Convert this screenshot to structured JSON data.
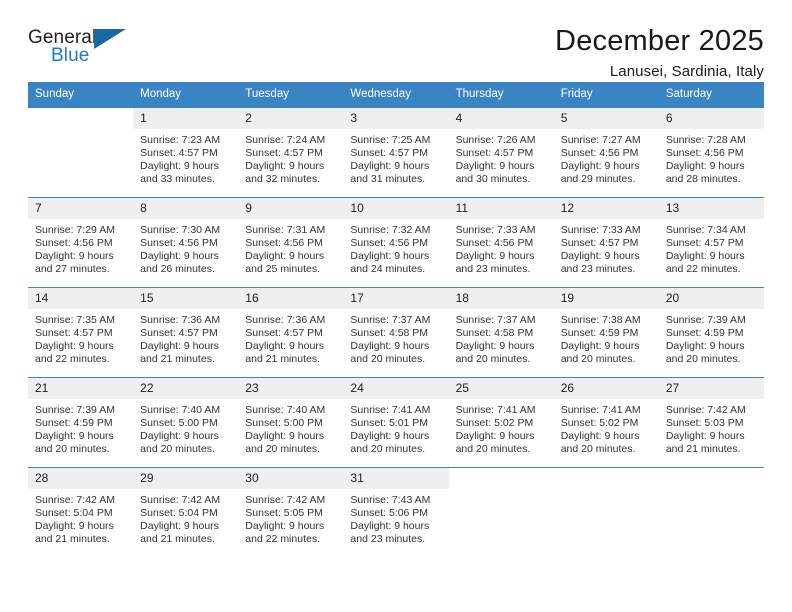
{
  "logo": {
    "word_one": "General",
    "word_two": "Blue",
    "triangle_color": "#17699f",
    "blue_color": "#1c7fc4"
  },
  "header": {
    "title": "December 2025",
    "subtitle": "Lanusei, Sardinia, Italy"
  },
  "theme": {
    "header_blue": "#3b84c4",
    "day_number_bg": "#efefef",
    "text": "#333333"
  },
  "calendar": {
    "weekday_headers": [
      "Sunday",
      "Monday",
      "Tuesday",
      "Wednesday",
      "Thursday",
      "Friday",
      "Saturday"
    ],
    "weeks": [
      [
        {
          "day": "",
          "sunrise": "",
          "sunset": "",
          "daylight_line1": "",
          "daylight_line2": ""
        },
        {
          "day": "1",
          "sunrise": "Sunrise: 7:23 AM",
          "sunset": "Sunset: 4:57 PM",
          "daylight_line1": "Daylight: 9 hours",
          "daylight_line2": "and 33 minutes."
        },
        {
          "day": "2",
          "sunrise": "Sunrise: 7:24 AM",
          "sunset": "Sunset: 4:57 PM",
          "daylight_line1": "Daylight: 9 hours",
          "daylight_line2": "and 32 minutes."
        },
        {
          "day": "3",
          "sunrise": "Sunrise: 7:25 AM",
          "sunset": "Sunset: 4:57 PM",
          "daylight_line1": "Daylight: 9 hours",
          "daylight_line2": "and 31 minutes."
        },
        {
          "day": "4",
          "sunrise": "Sunrise: 7:26 AM",
          "sunset": "Sunset: 4:57 PM",
          "daylight_line1": "Daylight: 9 hours",
          "daylight_line2": "and 30 minutes."
        },
        {
          "day": "5",
          "sunrise": "Sunrise: 7:27 AM",
          "sunset": "Sunset: 4:56 PM",
          "daylight_line1": "Daylight: 9 hours",
          "daylight_line2": "and 29 minutes."
        },
        {
          "day": "6",
          "sunrise": "Sunrise: 7:28 AM",
          "sunset": "Sunset: 4:56 PM",
          "daylight_line1": "Daylight: 9 hours",
          "daylight_line2": "and 28 minutes."
        }
      ],
      [
        {
          "day": "7",
          "sunrise": "Sunrise: 7:29 AM",
          "sunset": "Sunset: 4:56 PM",
          "daylight_line1": "Daylight: 9 hours",
          "daylight_line2": "and 27 minutes."
        },
        {
          "day": "8",
          "sunrise": "Sunrise: 7:30 AM",
          "sunset": "Sunset: 4:56 PM",
          "daylight_line1": "Daylight: 9 hours",
          "daylight_line2": "and 26 minutes."
        },
        {
          "day": "9",
          "sunrise": "Sunrise: 7:31 AM",
          "sunset": "Sunset: 4:56 PM",
          "daylight_line1": "Daylight: 9 hours",
          "daylight_line2": "and 25 minutes."
        },
        {
          "day": "10",
          "sunrise": "Sunrise: 7:32 AM",
          "sunset": "Sunset: 4:56 PM",
          "daylight_line1": "Daylight: 9 hours",
          "daylight_line2": "and 24 minutes."
        },
        {
          "day": "11",
          "sunrise": "Sunrise: 7:33 AM",
          "sunset": "Sunset: 4:56 PM",
          "daylight_line1": "Daylight: 9 hours",
          "daylight_line2": "and 23 minutes."
        },
        {
          "day": "12",
          "sunrise": "Sunrise: 7:33 AM",
          "sunset": "Sunset: 4:57 PM",
          "daylight_line1": "Daylight: 9 hours",
          "daylight_line2": "and 23 minutes."
        },
        {
          "day": "13",
          "sunrise": "Sunrise: 7:34 AM",
          "sunset": "Sunset: 4:57 PM",
          "daylight_line1": "Daylight: 9 hours",
          "daylight_line2": "and 22 minutes."
        }
      ],
      [
        {
          "day": "14",
          "sunrise": "Sunrise: 7:35 AM",
          "sunset": "Sunset: 4:57 PM",
          "daylight_line1": "Daylight: 9 hours",
          "daylight_line2": "and 22 minutes."
        },
        {
          "day": "15",
          "sunrise": "Sunrise: 7:36 AM",
          "sunset": "Sunset: 4:57 PM",
          "daylight_line1": "Daylight: 9 hours",
          "daylight_line2": "and 21 minutes."
        },
        {
          "day": "16",
          "sunrise": "Sunrise: 7:36 AM",
          "sunset": "Sunset: 4:57 PM",
          "daylight_line1": "Daylight: 9 hours",
          "daylight_line2": "and 21 minutes."
        },
        {
          "day": "17",
          "sunrise": "Sunrise: 7:37 AM",
          "sunset": "Sunset: 4:58 PM",
          "daylight_line1": "Daylight: 9 hours",
          "daylight_line2": "and 20 minutes."
        },
        {
          "day": "18",
          "sunrise": "Sunrise: 7:37 AM",
          "sunset": "Sunset: 4:58 PM",
          "daylight_line1": "Daylight: 9 hours",
          "daylight_line2": "and 20 minutes."
        },
        {
          "day": "19",
          "sunrise": "Sunrise: 7:38 AM",
          "sunset": "Sunset: 4:59 PM",
          "daylight_line1": "Daylight: 9 hours",
          "daylight_line2": "and 20 minutes."
        },
        {
          "day": "20",
          "sunrise": "Sunrise: 7:39 AM",
          "sunset": "Sunset: 4:59 PM",
          "daylight_line1": "Daylight: 9 hours",
          "daylight_line2": "and 20 minutes."
        }
      ],
      [
        {
          "day": "21",
          "sunrise": "Sunrise: 7:39 AM",
          "sunset": "Sunset: 4:59 PM",
          "daylight_line1": "Daylight: 9 hours",
          "daylight_line2": "and 20 minutes."
        },
        {
          "day": "22",
          "sunrise": "Sunrise: 7:40 AM",
          "sunset": "Sunset: 5:00 PM",
          "daylight_line1": "Daylight: 9 hours",
          "daylight_line2": "and 20 minutes."
        },
        {
          "day": "23",
          "sunrise": "Sunrise: 7:40 AM",
          "sunset": "Sunset: 5:00 PM",
          "daylight_line1": "Daylight: 9 hours",
          "daylight_line2": "and 20 minutes."
        },
        {
          "day": "24",
          "sunrise": "Sunrise: 7:41 AM",
          "sunset": "Sunset: 5:01 PM",
          "daylight_line1": "Daylight: 9 hours",
          "daylight_line2": "and 20 minutes."
        },
        {
          "day": "25",
          "sunrise": "Sunrise: 7:41 AM",
          "sunset": "Sunset: 5:02 PM",
          "daylight_line1": "Daylight: 9 hours",
          "daylight_line2": "and 20 minutes."
        },
        {
          "day": "26",
          "sunrise": "Sunrise: 7:41 AM",
          "sunset": "Sunset: 5:02 PM",
          "daylight_line1": "Daylight: 9 hours",
          "daylight_line2": "and 20 minutes."
        },
        {
          "day": "27",
          "sunrise": "Sunrise: 7:42 AM",
          "sunset": "Sunset: 5:03 PM",
          "daylight_line1": "Daylight: 9 hours",
          "daylight_line2": "and 21 minutes."
        }
      ],
      [
        {
          "day": "28",
          "sunrise": "Sunrise: 7:42 AM",
          "sunset": "Sunset: 5:04 PM",
          "daylight_line1": "Daylight: 9 hours",
          "daylight_line2": "and 21 minutes."
        },
        {
          "day": "29",
          "sunrise": "Sunrise: 7:42 AM",
          "sunset": "Sunset: 5:04 PM",
          "daylight_line1": "Daylight: 9 hours",
          "daylight_line2": "and 21 minutes."
        },
        {
          "day": "30",
          "sunrise": "Sunrise: 7:42 AM",
          "sunset": "Sunset: 5:05 PM",
          "daylight_line1": "Daylight: 9 hours",
          "daylight_line2": "and 22 minutes."
        },
        {
          "day": "31",
          "sunrise": "Sunrise: 7:43 AM",
          "sunset": "Sunset: 5:06 PM",
          "daylight_line1": "Daylight: 9 hours",
          "daylight_line2": "and 23 minutes."
        },
        {
          "day": "",
          "sunrise": "",
          "sunset": "",
          "daylight_line1": "",
          "daylight_line2": ""
        },
        {
          "day": "",
          "sunrise": "",
          "sunset": "",
          "daylight_line1": "",
          "daylight_line2": ""
        },
        {
          "day": "",
          "sunrise": "",
          "sunset": "",
          "daylight_line1": "",
          "daylight_line2": ""
        }
      ]
    ]
  }
}
